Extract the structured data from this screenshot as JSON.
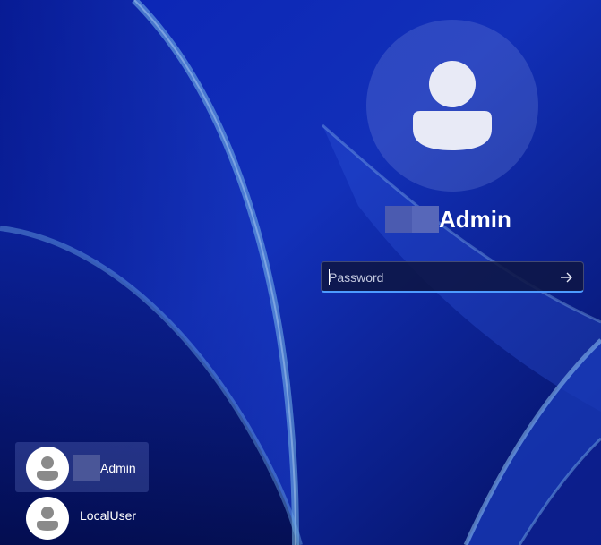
{
  "colors": {
    "background": "#0a1a8a",
    "accent": "#4d9bff",
    "text": "#ffffff"
  },
  "current_user": {
    "name_suffix": "Admin",
    "avatar_icon": "person-icon"
  },
  "password_field": {
    "placeholder": "Password",
    "value": "",
    "submit_icon": "arrow-right-icon"
  },
  "user_list": [
    {
      "name_suffix": "Admin",
      "selected": true,
      "avatar_icon": "person-icon"
    },
    {
      "name": "LocalUser",
      "selected": false,
      "avatar_icon": "person-icon"
    }
  ]
}
